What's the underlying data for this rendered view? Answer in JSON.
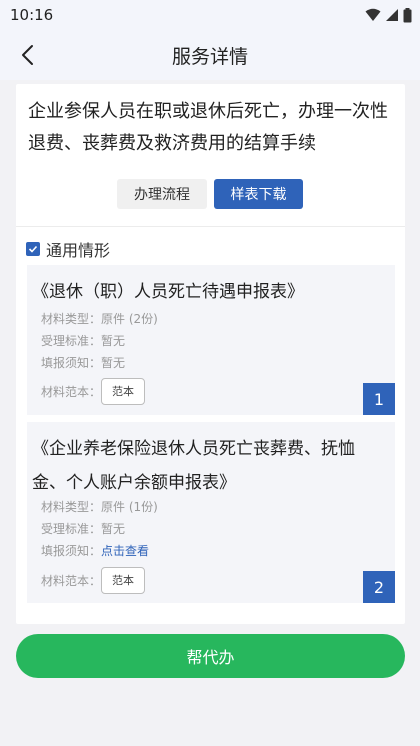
{
  "status_bar": {
    "time": "10:16",
    "icons": [
      "wifi-icon",
      "signal-icon",
      "battery-icon"
    ]
  },
  "header": {
    "title": "服务详情",
    "back_icon": "chevron-left-icon"
  },
  "service": {
    "title": "企业参保人员在职或退休后死亡，办理一次性退费、丧葬费及救济费用的结算手续"
  },
  "actions": {
    "process_label": "办理流程",
    "sample_download_label": "样表下载"
  },
  "scenario": {
    "label": "通用情形",
    "checked": true
  },
  "materials": [
    {
      "title": "《退休（职）人员死亡待遇申报表》",
      "type_label": "材料类型：",
      "type_value": "原件 (2份)",
      "standard_label": "受理标准：",
      "standard_value": "暂无",
      "notice_label": "填报须知：",
      "notice_value": "暂无",
      "sample_label": "材料范本：",
      "sample_button": "范本",
      "index": "1"
    },
    {
      "title": "《企业养老保险退休人员死亡丧葬费、抚恤金、个人账户余额申报表》",
      "type_label": "材料类型：",
      "type_value": "原件 (1份)",
      "standard_label": "受理标准：",
      "standard_value": "暂无",
      "notice_label": "填报须知：",
      "notice_value": "点击查看",
      "sample_label": "材料范本：",
      "sample_button": "范本",
      "index": "2"
    }
  ],
  "footer": {
    "agent_button": "帮代办"
  },
  "colors": {
    "accent_blue": "#2f63b9",
    "action_green": "#27b75d",
    "page_bg": "#f2f2f5"
  }
}
